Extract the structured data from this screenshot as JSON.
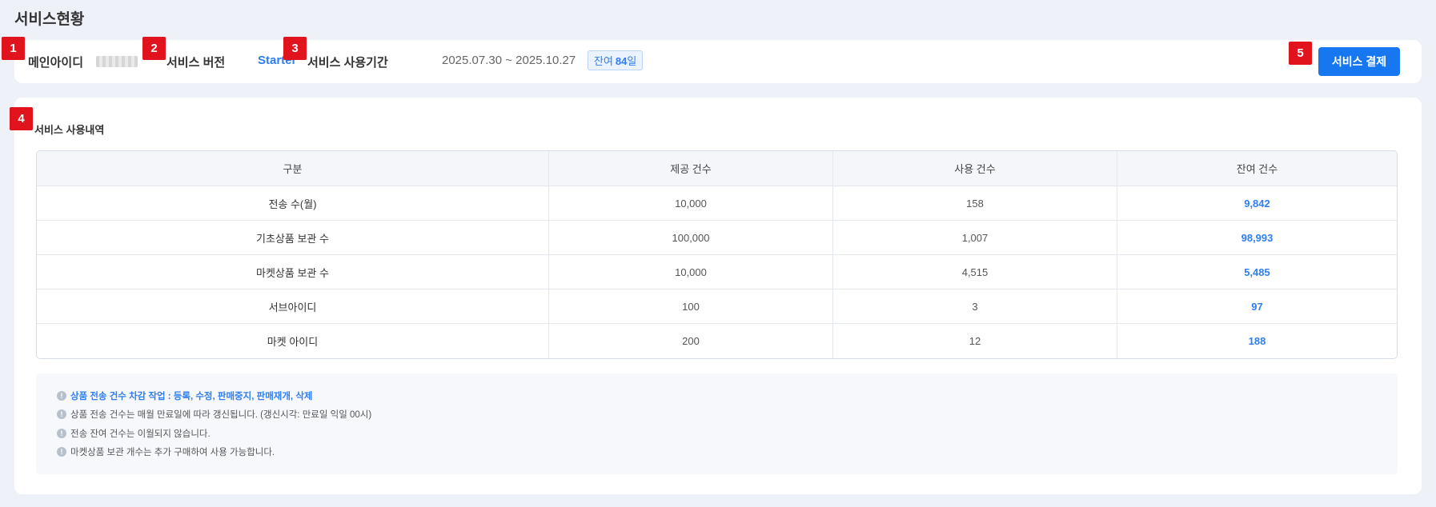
{
  "page": {
    "title": "서비스현황"
  },
  "markers": [
    "1",
    "2",
    "3",
    "4",
    "5"
  ],
  "info": {
    "main_id_label": "메인아이디",
    "version_label": "서비스 버전",
    "version_value": "Starter",
    "period_label": "서비스 사용기간",
    "period_value": "2025.07.30 ~ 2025.10.27",
    "remain_prefix": "잔여",
    "remain_days": "84",
    "remain_suffix": "일",
    "pay_button": "서비스 결제"
  },
  "usage": {
    "title": "서비스 사용내역",
    "columns": [
      "구분",
      "제공 건수",
      "사용 건수",
      "잔여 건수"
    ],
    "rows": [
      [
        "전송 수(월)",
        "10,000",
        "158",
        "9,842"
      ],
      [
        "기초상품 보관 수",
        "100,000",
        "1,007",
        "98,993"
      ],
      [
        "마켓상품 보관 수",
        "10,000",
        "4,515",
        "5,485"
      ],
      [
        "서브아이디",
        "100",
        "3",
        "97"
      ],
      [
        "마켓 아이디",
        "200",
        "12",
        "188"
      ]
    ]
  },
  "notes": [
    "상품 전송 건수 차감 작업 : 등록, 수정, 판매중지, 판매재개, 삭제",
    "상품 전송 건수는 매월 만료일에 따라 갱신됩니다. (갱신시각: 만료일 익일 00시)",
    "전송 잔여 건수는 이월되지 않습니다.",
    "마켓상품 보관 개수는 추가 구매하여 사용 가능합니다."
  ],
  "icons": {
    "note_icon": "info-circle-icon"
  },
  "colors": {
    "accent": "#1677f1",
    "marker": "#e1141d",
    "link_blue": "#2f7ef1"
  }
}
